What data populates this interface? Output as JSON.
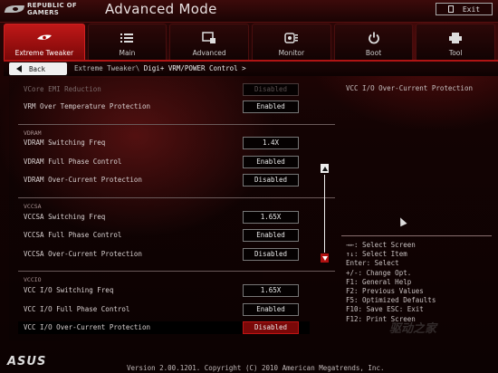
{
  "header": {
    "brand_line1": "REPUBLIC OF",
    "brand_line2": "GAMERS",
    "title": "Advanced Mode",
    "exit_label": "Exit"
  },
  "tabs": [
    {
      "label": "Extreme Tweaker",
      "icon": "rog-eye-icon",
      "active": true
    },
    {
      "label": "Main",
      "icon": "list-icon",
      "active": false
    },
    {
      "label": "Advanced",
      "icon": "cpu-chip-icon",
      "active": false
    },
    {
      "label": "Monitor",
      "icon": "gauge-icon",
      "active": false
    },
    {
      "label": "Boot",
      "icon": "power-icon",
      "active": false
    },
    {
      "label": "Tool",
      "icon": "printer-icon",
      "active": false
    }
  ],
  "breadcrumb": {
    "back_label": "Back",
    "path": "Extreme Tweaker\\",
    "current": "Digi+ VRM/POWER Control >"
  },
  "settings": {
    "vcore_emi": {
      "label": "VCore EMI Reduction",
      "value": "Disabled"
    },
    "vrm_otp": {
      "label": "VRM Over Temperature Protection",
      "value": "Enabled"
    },
    "vdram_section": "VDRAM",
    "vdram_freq": {
      "label": "VDRAM Switching Freq",
      "value": "1.4X"
    },
    "vdram_phase": {
      "label": "VDRAM Full Phase Control",
      "value": "Enabled"
    },
    "vdram_ocp": {
      "label": "VDRAM Over-Current Protection",
      "value": "Disabled"
    },
    "vccsa_section": "VCCSA",
    "vccsa_freq": {
      "label": "VCCSA Switching Freq",
      "value": "1.65X"
    },
    "vccsa_phase": {
      "label": "VCCSA Full Phase Control",
      "value": "Enabled"
    },
    "vccsa_ocp": {
      "label": "VCCSA Over-Current Protection",
      "value": "Disabled"
    },
    "vccio_section": "VCCIO",
    "vccio_freq": {
      "label": "VCC I/O Switching Freq",
      "value": "1.65X"
    },
    "vccio_phase": {
      "label": "VCC I/O Full Phase Control",
      "value": "Enabled"
    },
    "vccio_ocp": {
      "label": "VCC I/O Over-Current Protection",
      "value": "Disabled"
    }
  },
  "help": {
    "description": "VCC I/O Over-Current Protection",
    "keys": [
      "→←: Select Screen",
      "↑↓: Select Item",
      "Enter: Select",
      "+/-: Change Opt.",
      "F1: General Help",
      "F2: Previous Values",
      "F5: Optimized Defaults",
      "F10: Save  ESC: Exit",
      "F12: Print Screen"
    ]
  },
  "footer": {
    "brand": "ASUS",
    "version": "Version 2.00.1201. Copyright (C) 2010 American Megatrends, Inc."
  },
  "watermark": "驱动之家",
  "colors": {
    "accent": "#c01818",
    "background": "#0c0202",
    "selected": "#7a0808"
  }
}
